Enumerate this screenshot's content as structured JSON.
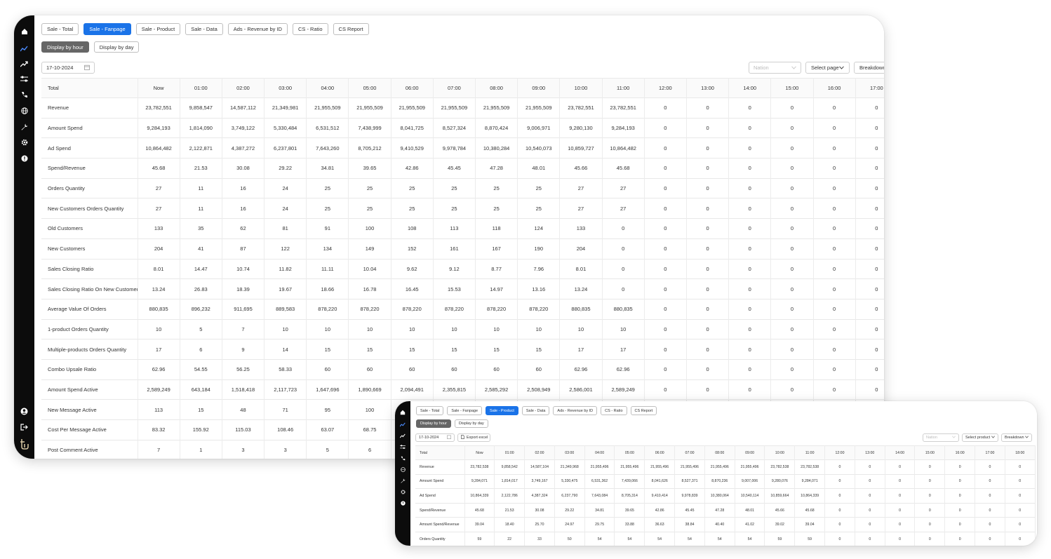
{
  "main_window": {
    "tabs": [
      {
        "label": "Sale - Total",
        "active": false
      },
      {
        "label": "Sale - Fanpage",
        "active": true
      },
      {
        "label": "Sale - Product",
        "active": false
      },
      {
        "label": "Sale - Data",
        "active": false
      },
      {
        "label": "Ads - Revenue by ID",
        "active": false
      },
      {
        "label": "CS - Ratio",
        "active": false
      },
      {
        "label": "CS Report",
        "active": false
      }
    ],
    "display_modes": [
      {
        "label": "Display by hour",
        "active": true
      },
      {
        "label": "Display by day",
        "active": false
      }
    ],
    "date": "17-10-2024",
    "nation_placeholder": "Nation",
    "select_page_label": "Select page",
    "breakdown_label": "Breakdown",
    "table": {
      "columns": [
        "Total",
        "Now",
        "01:00",
        "02:00",
        "03:00",
        "04:00",
        "05:00",
        "06:00",
        "07:00",
        "08:00",
        "09:00",
        "10:00",
        "11:00",
        "12:00",
        "13:00",
        "14:00",
        "15:00",
        "16:00",
        "17:00"
      ],
      "rows": [
        [
          "Revenue",
          "23,782,551",
          "9,858,547",
          "14,587,112",
          "21,349,981",
          "21,955,509",
          "21,955,509",
          "21,955,509",
          "21,955,509",
          "21,955,509",
          "21,955,509",
          "23,782,551",
          "23,782,551",
          "0",
          "0",
          "0",
          "0",
          "0",
          "0"
        ],
        [
          "Amount Spend",
          "9,284,193",
          "1,814,090",
          "3,749,122",
          "5,330,484",
          "6,531,512",
          "7,438,999",
          "8,041,725",
          "8,527,324",
          "8,870,424",
          "9,006,971",
          "9,280,130",
          "9,284,193",
          "0",
          "0",
          "0",
          "0",
          "0",
          "0"
        ],
        [
          "Ad Spend",
          "10,864,482",
          "2,122,871",
          "4,387,272",
          "6,237,801",
          "7,643,260",
          "8,705,212",
          "9,410,529",
          "9,978,784",
          "10,380,284",
          "10,540,073",
          "10,859,727",
          "10,864,482",
          "0",
          "0",
          "0",
          "0",
          "0",
          "0"
        ],
        [
          "Spend/Revenue",
          "45.68",
          "21.53",
          "30.08",
          "29.22",
          "34.81",
          "39.65",
          "42.86",
          "45.45",
          "47.28",
          "48.01",
          "45.66",
          "45.68",
          "0",
          "0",
          "0",
          "0",
          "0",
          "0"
        ],
        [
          "Orders Quantity",
          "27",
          "11",
          "16",
          "24",
          "25",
          "25",
          "25",
          "25",
          "25",
          "25",
          "27",
          "27",
          "0",
          "0",
          "0",
          "0",
          "0",
          "0"
        ],
        [
          "New Customers Orders Quantity",
          "27",
          "11",
          "16",
          "24",
          "25",
          "25",
          "25",
          "25",
          "25",
          "25",
          "27",
          "27",
          "0",
          "0",
          "0",
          "0",
          "0",
          "0"
        ],
        [
          "Old Customers",
          "133",
          "35",
          "62",
          "81",
          "91",
          "100",
          "108",
          "113",
          "118",
          "124",
          "133",
          "0",
          "0",
          "0",
          "0",
          "0",
          "0",
          "0"
        ],
        [
          "New Customers",
          "204",
          "41",
          "87",
          "122",
          "134",
          "149",
          "152",
          "161",
          "167",
          "190",
          "204",
          "0",
          "0",
          "0",
          "0",
          "0",
          "0",
          "0"
        ],
        [
          "Sales Closing Ratio",
          "8.01",
          "14.47",
          "10.74",
          "11.82",
          "11.11",
          "10.04",
          "9.62",
          "9.12",
          "8.77",
          "7.96",
          "8.01",
          "0",
          "0",
          "0",
          "0",
          "0",
          "0",
          "0"
        ],
        [
          "Sales Closing Ratio On New Customers",
          "13.24",
          "26.83",
          "18.39",
          "19.67",
          "18.66",
          "16.78",
          "16.45",
          "15.53",
          "14.97",
          "13.16",
          "13.24",
          "0",
          "0",
          "0",
          "0",
          "0",
          "0",
          "0"
        ],
        [
          "Average Value Of Orders",
          "880,835",
          "896,232",
          "911,695",
          "889,583",
          "878,220",
          "878,220",
          "878,220",
          "878,220",
          "878,220",
          "878,220",
          "880,835",
          "880,835",
          "0",
          "0",
          "0",
          "0",
          "0",
          "0"
        ],
        [
          "1-product Orders Quantity",
          "10",
          "5",
          "7",
          "10",
          "10",
          "10",
          "10",
          "10",
          "10",
          "10",
          "10",
          "10",
          "0",
          "0",
          "0",
          "0",
          "0",
          "0"
        ],
        [
          "Multiple-products Orders Quantity",
          "17",
          "6",
          "9",
          "14",
          "15",
          "15",
          "15",
          "15",
          "15",
          "15",
          "17",
          "17",
          "0",
          "0",
          "0",
          "0",
          "0",
          "0"
        ],
        [
          "Combo Upsale Ratio",
          "62.96",
          "54.55",
          "56.25",
          "58.33",
          "60",
          "60",
          "60",
          "60",
          "60",
          "60",
          "62.96",
          "62.96",
          "0",
          "0",
          "0",
          "0",
          "0",
          "0"
        ],
        [
          "Amount Spend Active",
          "2,589,249",
          "643,184",
          "1,518,418",
          "2,117,723",
          "1,647,696",
          "1,890,669",
          "2,094,491",
          "2,355,815",
          "2,585,292",
          "2,508,949",
          "2,586,001",
          "2,589,249",
          "0",
          "0",
          "0",
          "0",
          "0",
          "0"
        ],
        [
          "New Message Active",
          "113",
          "15",
          "48",
          "71",
          "95",
          "100",
          "",
          "",
          "",
          "",
          "",
          "",
          "",
          "",
          "",
          "",
          "",
          ""
        ],
        [
          "Cost Per Message Active",
          "83.32",
          "155.92",
          "115.03",
          "108.46",
          "63.07",
          "68.75",
          "",
          "",
          "",
          "",
          "",
          "",
          "",
          "",
          "",
          "",
          "",
          ""
        ],
        [
          "Post Comment Active",
          "7",
          "1",
          "3",
          "3",
          "5",
          "6",
          "",
          "",
          "",
          "",
          "",
          "",
          "",
          "",
          "",
          "",
          "",
          ""
        ]
      ]
    }
  },
  "overlay_window": {
    "tabs": [
      {
        "label": "Sale - Total",
        "active": false
      },
      {
        "label": "Sale - Fanpage",
        "active": false
      },
      {
        "label": "Sale - Product",
        "active": true
      },
      {
        "label": "Sale - Data",
        "active": false
      },
      {
        "label": "Ads - Revenue by ID",
        "active": false
      },
      {
        "label": "CS - Ratio",
        "active": false
      },
      {
        "label": "CS Report",
        "active": false
      }
    ],
    "display_modes": [
      {
        "label": "Display by hour",
        "active": true
      },
      {
        "label": "Display by day",
        "active": false
      }
    ],
    "date": "17-10-2024",
    "export_label": "Export excel",
    "nation_placeholder": "Nation",
    "select_product_label": "Select product",
    "breakdown_label": "Breakdown",
    "table": {
      "columns": [
        "Total",
        "Now",
        "01:00",
        "02:00",
        "03:00",
        "04:00",
        "05:00",
        "06:00",
        "07:00",
        "08:00",
        "09:00",
        "10:00",
        "11:00",
        "12:00",
        "13:00",
        "14:00",
        "15:00",
        "16:00",
        "17:00",
        "18:00"
      ],
      "rows": [
        [
          "Revenue",
          "23,782,538",
          "9,858,542",
          "14,587,104",
          "21,349,968",
          "21,955,496",
          "21,955,496",
          "21,955,496",
          "21,955,496",
          "21,955,496",
          "21,955,496",
          "23,782,538",
          "23,782,538",
          "0",
          "0",
          "0",
          "0",
          "0",
          "0",
          "0"
        ],
        [
          "Amount Spend",
          "9,284,071",
          "1,814,017",
          "3,749,167",
          "5,330,475",
          "6,531,362",
          "7,439,066",
          "8,041,626",
          "8,527,371",
          "8,870,236",
          "9,007,006",
          "9,280,076",
          "9,284,071",
          "0",
          "0",
          "0",
          "0",
          "0",
          "0",
          "0"
        ],
        [
          "Ad Spend",
          "10,864,339",
          "2,122,786",
          "4,387,324",
          "6,237,790",
          "7,643,084",
          "8,705,314",
          "9,410,414",
          "9,978,839",
          "10,380,064",
          "10,540,114",
          "10,859,664",
          "10,864,339",
          "0",
          "0",
          "0",
          "0",
          "0",
          "0",
          "0"
        ],
        [
          "Spend/Revenue",
          "45.68",
          "21.53",
          "30.08",
          "29.22",
          "34.81",
          "39.65",
          "42.86",
          "45.45",
          "47.28",
          "48.01",
          "45.66",
          "45.68",
          "0",
          "0",
          "0",
          "0",
          "0",
          "0",
          "0"
        ],
        [
          "Amount Spend/Revenue",
          "39.04",
          "18.40",
          "25.70",
          "24.97",
          "29.75",
          "33.88",
          "36.63",
          "38.84",
          "40.40",
          "41.02",
          "39.02",
          "39.04",
          "0",
          "0",
          "0",
          "0",
          "0",
          "0",
          "0"
        ],
        [
          "Orders Quantity",
          "59",
          "22",
          "33",
          "50",
          "54",
          "54",
          "54",
          "54",
          "54",
          "54",
          "59",
          "59",
          "0",
          "0",
          "0",
          "0",
          "0",
          "0",
          "0"
        ]
      ]
    }
  },
  "sidebar_icons": [
    "home-icon",
    "chart-line-icon",
    "trending-up-icon",
    "sliders-icon",
    "phone-icon",
    "globe-icon",
    "wrench-icon",
    "gear-icon",
    "alert-icon"
  ],
  "sidebar_bottom_icons": [
    "user-icon",
    "logout-icon",
    "brand-logo-icon"
  ],
  "colors": {
    "accent": "#1a73e8",
    "sidebar": "#0c0c0c",
    "active_mode": "#666666"
  }
}
